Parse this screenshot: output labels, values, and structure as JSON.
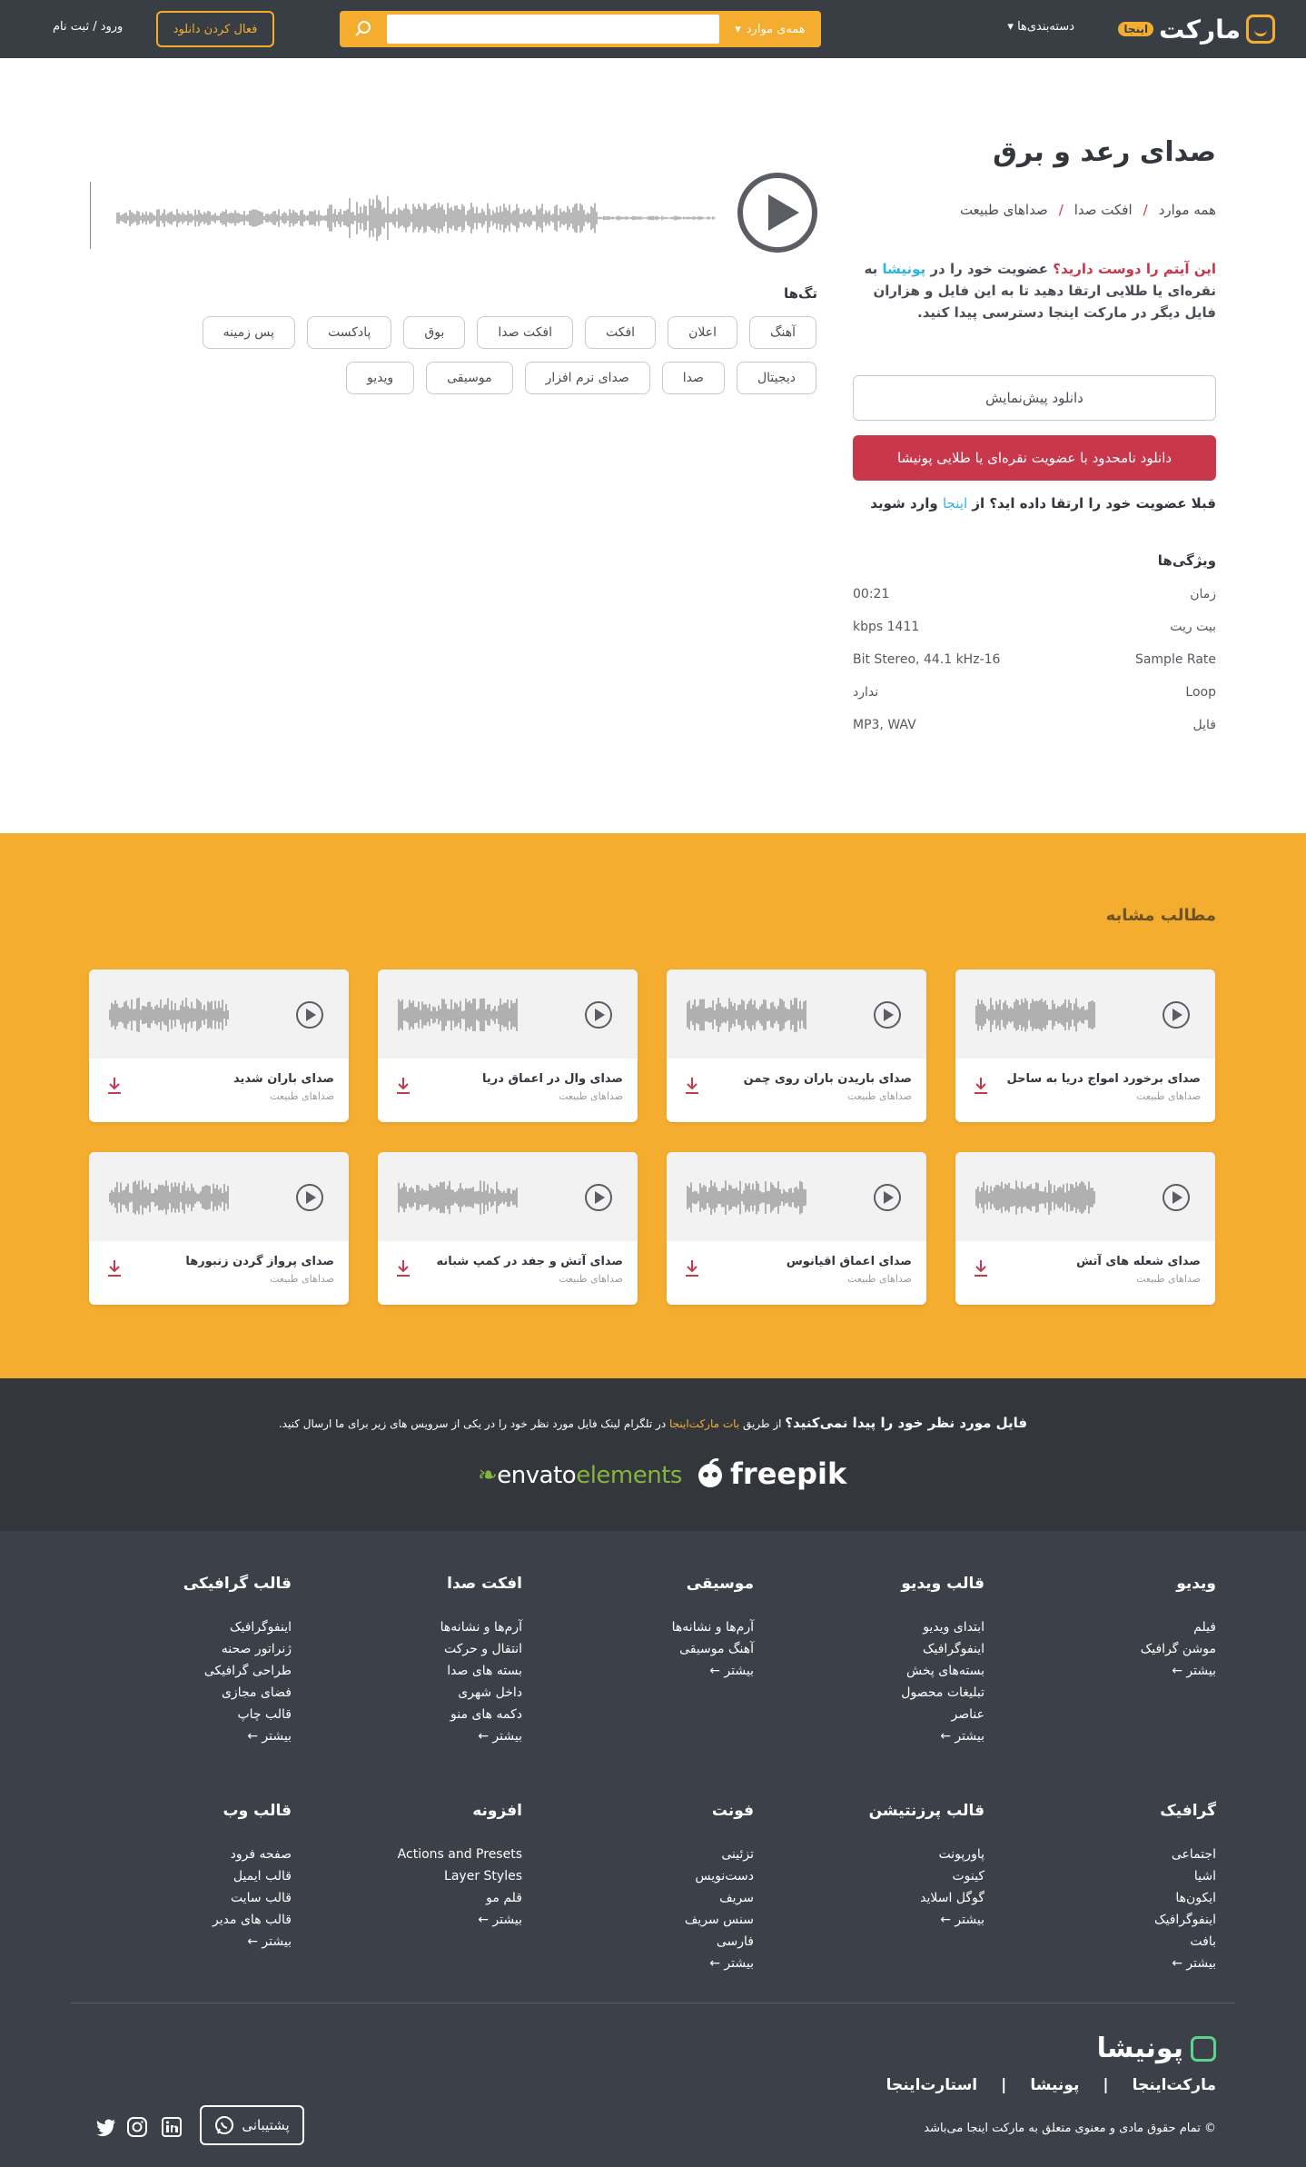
{
  "header": {
    "brand": "مارکت",
    "brand_badge": "اینجا",
    "categories": "دسته‌بندی‌ها",
    "search_scope": "همه‌ی موارد",
    "search_placeholder": "",
    "activate_download": "فعال کردن دانلود",
    "login": "ورود / ثبت نام"
  },
  "product": {
    "title": "صدای رعد و برق",
    "breadcrumb": [
      "همه موارد",
      "افکت صدا",
      "صداهای طبیعت"
    ],
    "promo_q": "این آیتم را دوست دارید؟",
    "promo_1": " عضویت خود را در ",
    "promo_brand": "پونیشا",
    "promo_2": " به نقره‌ای یا طلایی ارتقا دهید تا به این فایل و هزاران فایل دیگر در مارکت اینجا دسترسی پیدا کنید.",
    "preview_button": "دانلود پیش‌نمایش",
    "unlimited_button": "دانلود نامحدود با عضویت نقره‌ای یا طلایی پونیشا",
    "login_hint_1": "قبلا عضویت خود را ارتقا داده اید؟ از ",
    "login_hint_link": "اینجا",
    "login_hint_2": " وارد شوید",
    "specs_title": "ویژگی‌ها",
    "specs": [
      {
        "label": "زمان",
        "value": "00:21"
      },
      {
        "label": "بیت ریت",
        "value": "1411 kbps"
      },
      {
        "label": "Sample Rate",
        "value": "16-Bit Stereo, 44.1 kHz"
      },
      {
        "label": "Loop",
        "value": "ندارد"
      },
      {
        "label": "فایل",
        "value": "MP3, WAV"
      }
    ],
    "tags_title": "تگ‌ها",
    "tags": [
      "آهنگ",
      "اعلان",
      "افکت",
      "افکت صدا",
      "بوق",
      "پادکست",
      "پس زمینه",
      "دیجیتال",
      "صدا",
      "صدای نرم افزار",
      "موسیقی",
      "ویدیو"
    ]
  },
  "related": {
    "title": "مطالب مشابه",
    "items": [
      {
        "title": "صدای برخورد امواج دریا به ساحل",
        "category": "صداهای طبیعت"
      },
      {
        "title": "صدای باریدن باران روی چمن",
        "category": "صداهای طبیعت"
      },
      {
        "title": "صدای وال در اعماق دریا",
        "category": "صداهای طبیعت"
      },
      {
        "title": "صدای باران شدید",
        "category": "صداهای طبیعت"
      },
      {
        "title": "صدای شعله های آتش",
        "category": "صداهای طبیعت"
      },
      {
        "title": "صدای اعماق اقیانوس",
        "category": "صداهای طبیعت"
      },
      {
        "title": "صدای آتش و جفد در کمپ شبانه",
        "category": "صداهای طبیعت"
      },
      {
        "title": "صدای پرواز گردن زنبورها",
        "category": "صداهای طبیعت"
      }
    ]
  },
  "cta": {
    "question": "فایل مورد نظر خود را پیدا نمی‌کنید؟",
    "text_1": "  از طریق ",
    "bot": "بات مارکت‌اینجا",
    "text_2": " در تلگرام لینک فایل مورد نظر خود را در یکی از سرویس های زیر برای ما ارسال کنید.",
    "envato_1": "envato",
    "envato_2": "elements",
    "freepik": "freepik"
  },
  "footer": {
    "columns": [
      {
        "title": "ویدیو",
        "links": [
          "فیلم",
          "موشن گرافیک",
          "بیشتر ←"
        ]
      },
      {
        "title": "قالب ویدیو",
        "links": [
          "ابتدای ویدیو",
          "اینفوگرافیک",
          "بسته‌های پخش",
          "تبلیغات محصول",
          "عناصر",
          "بیشتر ←"
        ]
      },
      {
        "title": "موسیقی",
        "links": [
          "آرم‌ها و نشانه‌ها",
          "آهنگ موسیقی",
          "بیشتر ←"
        ]
      },
      {
        "title": "افکت صدا",
        "links": [
          "آرم‌ها و نشانه‌ها",
          "انتقال و حرکت",
          "بسته های صدا",
          "داخل شهری",
          "دکمه های منو",
          "بیشتر ←"
        ]
      },
      {
        "title": "قالب گرافیکی",
        "links": [
          "اینفوگرافیک",
          "ژنراتور صحنه",
          "طراحی گرافیکی",
          "فضای مجازی",
          "قالب چاپ",
          "بیشتر ←"
        ]
      },
      {
        "title": "گرافیک",
        "links": [
          "اجتماعی",
          "اشیا",
          "ایکون‌ها",
          "اینفوگرافیک",
          "بافت",
          "بیشتر ←"
        ]
      },
      {
        "title": "قالب پرزنتیشن",
        "links": [
          "پاورپونت",
          "کینوت",
          "گوگل اسلاید",
          "بیشتر ←"
        ]
      },
      {
        "title": "فونت",
        "links": [
          "تزئینی",
          "دست‌نویس",
          "سریف",
          "سنس سریف",
          "فارسی",
          "بیشتر ←"
        ]
      },
      {
        "title": "افزونه",
        "links": [
          "Actions and Presets",
          "Layer Styles",
          "قلم مو",
          "بیشتر ←"
        ]
      },
      {
        "title": "قالب وب",
        "links": [
          "صفحه فرود",
          "قالب ایمیل",
          "قالب سایت",
          "قالب های مدیر",
          "بیشتر ←"
        ]
      }
    ],
    "brand": "پونیشا",
    "links": [
      "مارکت‌اینجا",
      "|",
      "پونیشا",
      "|",
      "استارت‌اینجا"
    ],
    "copyright": "© تمام حقوق مادی و معنوی متعلق به مارکت اینجا می‌باشد",
    "support": "پشتیبانی"
  },
  "colors": {
    "accent": "#f5ad30",
    "dark": "#393d44",
    "danger": "#c8374c",
    "link": "#2ab4e8"
  }
}
